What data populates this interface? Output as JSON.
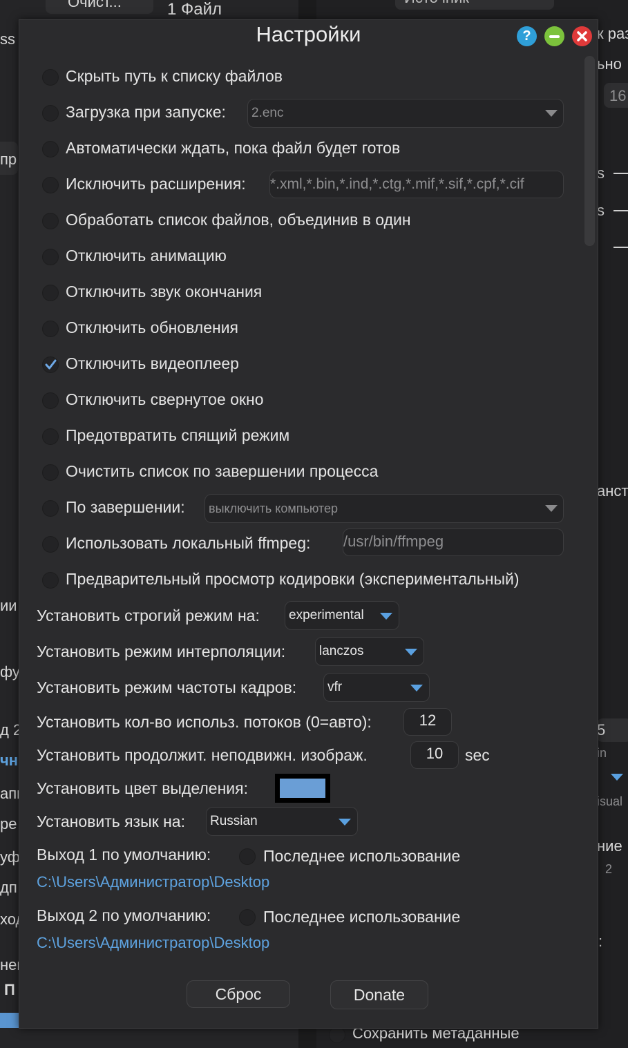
{
  "background": {
    "top_button": "Очист...",
    "file_count": "1 Файл",
    "top_right_label": "Источник",
    "left_fragments": [
      "ss",
      "пр",
      "ии",
      "фу",
      "д 2",
      "чн",
      "апк",
      "ре",
      "уф",
      "дп",
      "ход",
      "нен",
      "П"
    ],
    "right_fragments": [
      "к раз",
      "ьно",
      "16",
      "s",
      "s",
      "анст",
      "5",
      "in",
      "isual",
      "ние",
      "2",
      ":"
    ],
    "bottom_option": "Сохранить метаданные"
  },
  "dialog": {
    "title": "Настройки",
    "help_icon": "?",
    "options": [
      {
        "label": "Скрыть путь к списку файлов",
        "checked": false
      },
      {
        "label": "Загрузка при запуске:",
        "checked": false,
        "dropdown": "2.enc"
      },
      {
        "label": "Автоматически ждать, пока файл будет готов",
        "checked": false
      },
      {
        "label": "Исключить расширения:",
        "checked": false,
        "input": "*.xml,*.bin,*.ind,*.ctg,*.mif,*.sif,*.cpf,*.cif"
      },
      {
        "label": "Обработать список файлов, объединив в один",
        "checked": false
      },
      {
        "label": "Отключить анимацию",
        "checked": false
      },
      {
        "label": "Отключить звук окончания",
        "checked": false
      },
      {
        "label": "Отключить обновления",
        "checked": false
      },
      {
        "label": "Отключить видеоплеер",
        "checked": true
      },
      {
        "label": "Отключить свернутое окно",
        "checked": false
      },
      {
        "label": "Предотвратить спящий режим",
        "checked": false
      },
      {
        "label": "Очистить список по завершении процесса",
        "checked": false
      },
      {
        "label": "По завершении:",
        "checked": false,
        "dropdown": "выключить компьютер"
      },
      {
        "label": "Использовать локальный ffmpeg:",
        "checked": false,
        "input": "/usr/bin/ffmpeg"
      },
      {
        "label": "Предварительный просмотр кодировки (экспериментальный)",
        "checked": false
      }
    ],
    "strict": {
      "label": "Установить строгий режим на:",
      "value": "experimental"
    },
    "interp": {
      "label": "Установить режим интерполяции:",
      "value": "lanczos"
    },
    "framerate": {
      "label": "Установить режим частоты кадров:",
      "value": "vfr"
    },
    "threads": {
      "label": "Установить кол-во использ. потоков (0=авто):",
      "value": "12"
    },
    "still": {
      "label": "Установить продолжит. неподвижн. изображ.",
      "value": "10",
      "unit": "sec"
    },
    "highlight": {
      "label": "Установить цвет выделения:",
      "color": "#6a9ed6"
    },
    "language": {
      "label": "Установить язык на:",
      "value": "Russian"
    },
    "out1": {
      "label": "Выход 1 по умолчанию:",
      "last_used": "Последнее использование",
      "path": "C:\\Users\\Администратор\\Desktop"
    },
    "out2": {
      "label": "Выход 2 по умолчанию:",
      "last_used": "Последнее использование",
      "path": "C:\\Users\\Администратор\\Desktop"
    },
    "reset_button": "Сброс",
    "donate_button": "Donate"
  }
}
